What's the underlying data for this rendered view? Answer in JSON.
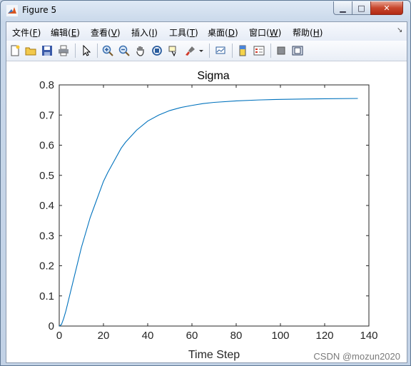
{
  "window": {
    "title": "Figure 5"
  },
  "title_buttons": {
    "minimize": "▁",
    "maximize": "□",
    "close": "✕"
  },
  "menu": {
    "items": [
      {
        "label": "文件(",
        "key": "F",
        "tail": ")"
      },
      {
        "label": "编辑(",
        "key": "E",
        "tail": ")"
      },
      {
        "label": "查看(",
        "key": "V",
        "tail": ")"
      },
      {
        "label": "插入(",
        "key": "I",
        "tail": ")"
      },
      {
        "label": "工具(",
        "key": "T",
        "tail": ")"
      },
      {
        "label": "桌面(",
        "key": "D",
        "tail": ")"
      },
      {
        "label": "窗口(",
        "key": "W",
        "tail": ")"
      },
      {
        "label": "帮助(",
        "key": "H",
        "tail": ")"
      }
    ],
    "overflow_icon": "↘"
  },
  "toolbar": {
    "icons": [
      "new-figure-icon",
      "open-file-icon",
      "save-icon",
      "print-icon",
      "pointer-icon",
      "zoom-in-icon",
      "zoom-out-icon",
      "pan-hand-icon",
      "rotate-3d-icon",
      "data-cursor-icon",
      "brush-icon",
      "link-plot-icon",
      "colorbar-icon",
      "legend-icon",
      "hide-plot-tools-icon",
      "show-plot-tools-icon"
    ]
  },
  "chart_data": {
    "type": "line",
    "title": "Sigma",
    "xlabel": "Time Step",
    "ylabel": "",
    "xlim": [
      0,
      140
    ],
    "ylim": [
      0,
      0.8
    ],
    "xticks": [
      0,
      20,
      40,
      60,
      80,
      100,
      120,
      140
    ],
    "yticks": [
      0,
      0.1,
      0.2,
      0.3,
      0.4,
      0.5,
      0.6,
      0.7,
      0.8
    ],
    "series": [
      {
        "color": "#0072bd",
        "x": [
          0,
          1,
          2,
          3,
          4,
          5,
          6,
          8,
          10,
          12,
          14,
          16,
          18,
          20,
          22,
          25,
          28,
          30,
          35,
          40,
          45,
          50,
          55,
          60,
          65,
          70,
          80,
          90,
          100,
          110,
          120,
          135
        ],
        "y": [
          0,
          0.005,
          0.025,
          0.05,
          0.08,
          0.11,
          0.14,
          0.2,
          0.26,
          0.31,
          0.36,
          0.4,
          0.44,
          0.48,
          0.51,
          0.55,
          0.59,
          0.61,
          0.65,
          0.68,
          0.7,
          0.715,
          0.725,
          0.732,
          0.738,
          0.742,
          0.747,
          0.75,
          0.752,
          0.753,
          0.754,
          0.755
        ]
      }
    ],
    "grid": false
  },
  "watermark": "CSDN @mozun2020"
}
